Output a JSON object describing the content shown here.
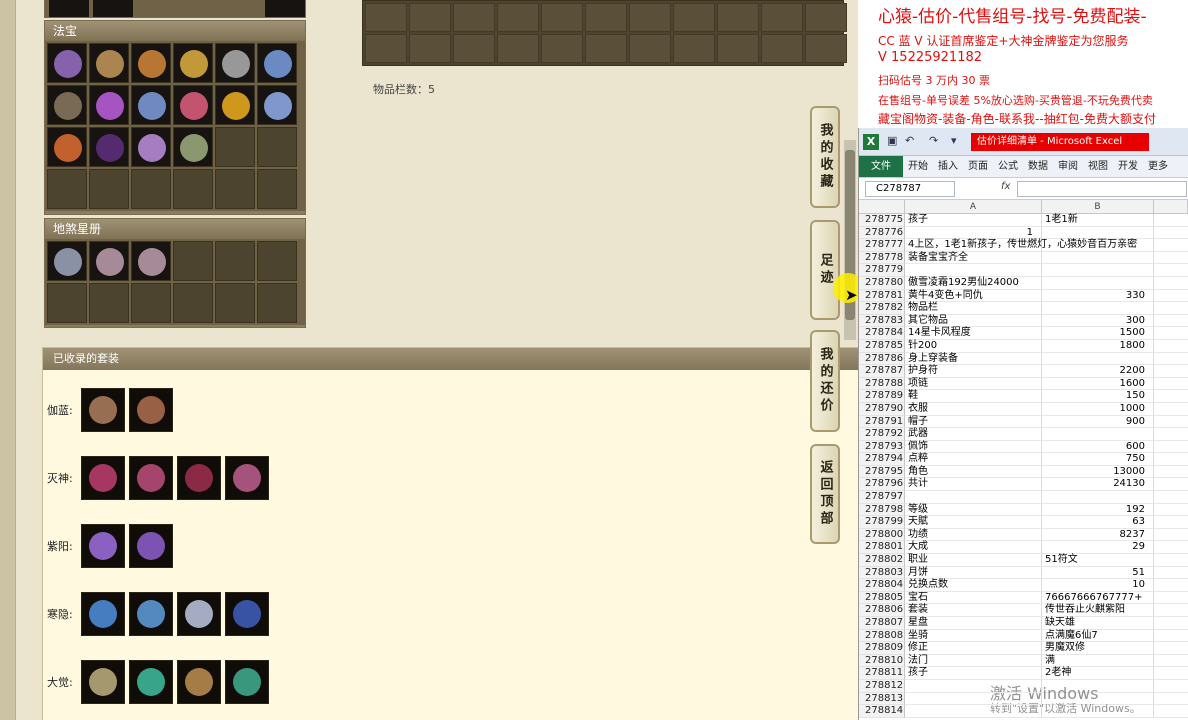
{
  "game": {
    "fabao_label": "法宝",
    "dishaxing_label": "地煞星册",
    "item_count_text": "物品栏数：5",
    "suits_header": "已收录的套装",
    "suits": [
      {
        "label": "伽蓝:",
        "count": 2
      },
      {
        "label": "灭神:",
        "count": 4
      },
      {
        "label": "紫阳:",
        "count": 2
      },
      {
        "label": "寒隐:",
        "count": 4
      },
      {
        "label": "大觉:",
        "count": 4
      }
    ],
    "side_buttons": [
      "我的收藏",
      "足迹",
      "我的还价",
      "返回顶部"
    ]
  },
  "overlay": {
    "line1": "心猿-估价-代售组号-找号-免费配装-",
    "line2": "CC 蓝 V 认证首席鉴定+大神金牌鉴定为您服务",
    "line3": "V 15225921182",
    "line4": "扫码估号 3 万内 30 票",
    "line5": "在售组号-单号误差 5%放心选购-买贵管退-不玩免费代卖",
    "line6": "藏宝阁物资-装备-角色-联系我--抽红包-免费大额支付"
  },
  "excel": {
    "title": "估价详细清单 - Microsoft Excel",
    "menus": [
      "文件",
      "开始",
      "插入",
      "页面",
      "公式",
      "数据",
      "审阅",
      "视图",
      "开发",
      "更多"
    ],
    "name_box": "C278787",
    "fx": "fx",
    "columns": [
      "A",
      "B"
    ],
    "rows": [
      {
        "n": "278775",
        "a": "孩子",
        "b": "1老1新",
        "bt": "txt"
      },
      {
        "n": "278776",
        "a": "1",
        "b": "",
        "an": true
      },
      {
        "n": "278777",
        "a": "4上区，1老1新孩子，传世燃灯，心猿妙音百万亲密",
        "b": ""
      },
      {
        "n": "278778",
        "a": "装备宝宝齐全",
        "b": ""
      },
      {
        "n": "278779",
        "a": "",
        "b": ""
      },
      {
        "n": "278780",
        "a": "傲雪凌霜192男仙24000",
        "b": ""
      },
      {
        "n": "278781",
        "a": "黄牛4变色+同仇",
        "b": "330"
      },
      {
        "n": "278782",
        "a": "物品栏",
        "b": ""
      },
      {
        "n": "278783",
        "a": "其它物品",
        "b": "300"
      },
      {
        "n": "278784",
        "a": "14星卡风程度",
        "b": "1500"
      },
      {
        "n": "278785",
        "a": "针200",
        "b": "1800"
      },
      {
        "n": "278786",
        "a": "身上穿装备",
        "b": ""
      },
      {
        "n": "278787",
        "a": "护身符",
        "b": "2200"
      },
      {
        "n": "278788",
        "a": "项链",
        "b": "1600"
      },
      {
        "n": "278789",
        "a": "鞋",
        "b": "150"
      },
      {
        "n": "278790",
        "a": "衣服",
        "b": "1000"
      },
      {
        "n": "278791",
        "a": "帽子",
        "b": "900"
      },
      {
        "n": "278792",
        "a": "武器",
        "b": ""
      },
      {
        "n": "278793",
        "a": "佩饰",
        "b": "600"
      },
      {
        "n": "278794",
        "a": "点粹",
        "b": "750"
      },
      {
        "n": "278795",
        "a": "角色",
        "b": "13000"
      },
      {
        "n": "278796",
        "a": "共计",
        "b": "24130"
      },
      {
        "n": "278797",
        "a": "",
        "b": ""
      },
      {
        "n": "278798",
        "a": "等级",
        "b": "192"
      },
      {
        "n": "278799",
        "a": "天賦",
        "b": "63"
      },
      {
        "n": "278800",
        "a": "功绩",
        "b": "8237"
      },
      {
        "n": "278801",
        "a": "大成",
        "b": "29"
      },
      {
        "n": "278802",
        "a": "职业",
        "b": "51符文",
        "bt": "txt"
      },
      {
        "n": "278803",
        "a": "月饼",
        "b": "51"
      },
      {
        "n": "278804",
        "a": "兑换点数",
        "b": "10"
      },
      {
        "n": "278805",
        "a": "宝石",
        "b": "76667666767777+",
        "bt": "txt"
      },
      {
        "n": "278806",
        "a": "套装",
        "b": "传世吞止火麒紫阳",
        "bt": "txt"
      },
      {
        "n": "278807",
        "a": "星盘",
        "b": "缺天雄",
        "bt": "txt"
      },
      {
        "n": "278808",
        "a": "坐骑",
        "b": "点满魔6仙7",
        "bt": "txt"
      },
      {
        "n": "278809",
        "a": "修正",
        "b": "男魔双修",
        "bt": "txt"
      },
      {
        "n": "278810",
        "a": "法门",
        "b": "满",
        "bt": "txt"
      },
      {
        "n": "278811",
        "a": "孩子",
        "b": "2老神",
        "bt": "txt"
      },
      {
        "n": "278812",
        "a": "",
        "b": ""
      },
      {
        "n": "278813",
        "a": "",
        "b": ""
      },
      {
        "n": "278814",
        "a": "",
        "b": ""
      }
    ]
  },
  "watermark": {
    "line1": "激活 Windows",
    "line2": "转到\"设置\"以激活 Windows。"
  }
}
